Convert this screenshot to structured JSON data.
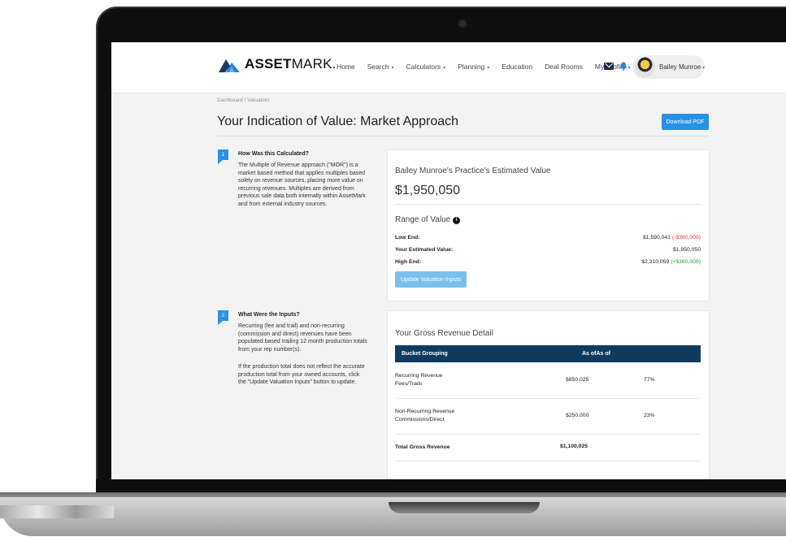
{
  "brand": {
    "name_bold": "ASSET",
    "name_light": "MARK.",
    "accent": "#2892e6",
    "navy": "#0f3b5f"
  },
  "nav": {
    "items": [
      {
        "label": "Home",
        "has_caret": false
      },
      {
        "label": "Search",
        "has_caret": true
      },
      {
        "label": "Calculators",
        "has_caret": true
      },
      {
        "label": "Planning",
        "has_caret": true
      },
      {
        "label": "Education",
        "has_caret": false
      },
      {
        "label": "Deal Rooms",
        "has_caret": false
      },
      {
        "label": "My Profile",
        "has_caret": true
      }
    ],
    "caret_glyph": "▾",
    "user_name": "Bailey Munroe",
    "icons": [
      "mail-icon",
      "bell-icon",
      "avatar"
    ]
  },
  "breadcrumb": "Dashboard  /  Valuation",
  "page": {
    "title": "Your Indication of Value: Market Approach",
    "download_label": "Download PDF"
  },
  "steps": [
    {
      "number": "1",
      "title": "How Was this Calculated?",
      "body": "The Multiple of Revenue approach (\"MOR\") is a market based method that applies multiples based solely on revenue sources, placing more value on recurring revenues. Multiples are derived from previous sale data both internally within AssetMark and from external industry sources."
    },
    {
      "number": "2",
      "title": "What Were the Inputs?",
      "body": "Recurring (fee and trail) and non-recurring (commission and direct) revenues have been populated based trailing 12 month production totals from your rep number(s).",
      "body2": "If the production total does not reflect the accurate production total from your owned accounts, click the \"Update Valuation Inputs\" button to update."
    }
  ],
  "estimate": {
    "label": "Bailey Munroe's Practice's Estimated Value",
    "value": "$1,950,050",
    "range_title": "Range of Value",
    "info_glyph": "i",
    "rows": [
      {
        "label": "Low End:",
        "value": "$1,590,041",
        "delta": "(-$360,009)",
        "delta_color": "#e53935"
      },
      {
        "label": "Your Estimated Value:",
        "value": "$1,950,050",
        "delta": "",
        "delta_color": ""
      },
      {
        "label": "High End:",
        "value": "$2,310,059",
        "delta": "(+$360,009)",
        "delta_color": "#2e9b3f"
      }
    ],
    "update_label": "Update Valuation Inputs"
  },
  "revenue": {
    "title": "Your Gross Revenue Detail",
    "headers": [
      "Bucket Grouping",
      "As ofAs of",
      ""
    ],
    "rows": [
      {
        "line1": "Recurring Revenue",
        "line2": "Fees/Trails",
        "amount": "$850,025",
        "pct": "77%"
      },
      {
        "line1": "Non-Recurring Revenue",
        "line2": "Commissions/Direct",
        "amount": "$250,000",
        "pct": "23%"
      }
    ],
    "total_label": "Total Gross Revenue",
    "total_amount": "$1,100,025"
  }
}
